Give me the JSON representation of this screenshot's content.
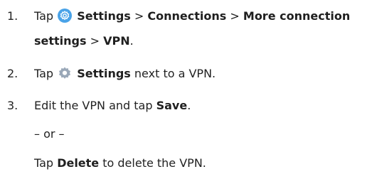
{
  "steps": [
    {
      "number": "1.",
      "tap": "Tap",
      "settings": "Settings",
      "sep1": ">",
      "connections": "Connections",
      "sep2": ">",
      "more_connection": "More connection",
      "settings_cont": "settings",
      "sep3": ">",
      "vpn": "VPN",
      "end": "."
    },
    {
      "number": "2.",
      "tap": "Tap",
      "settings": "Settings",
      "rest": "next to a VPN."
    },
    {
      "number": "3.",
      "pre": "Edit the VPN and tap",
      "save": "Save",
      "end": "."
    }
  ],
  "or_text": "– or –",
  "delete_line": {
    "tap": "Tap",
    "delete": "Delete",
    "rest": "to delete the VPN."
  },
  "icons": {
    "step1_icon": "settings-gear-icon",
    "step2_icon": "settings-gear-icon",
    "step1_color": "#4aa3e8",
    "step2_color": "#9aa8b8"
  }
}
